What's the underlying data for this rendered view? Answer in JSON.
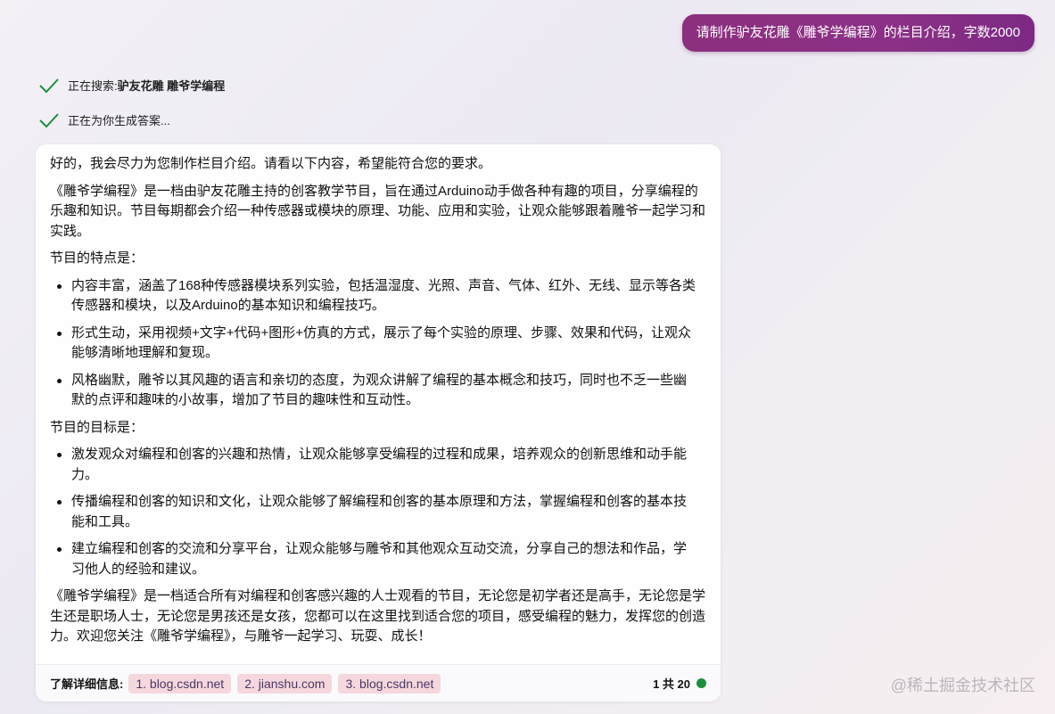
{
  "user_message": "请制作驴友花雕《雕爷学编程》的栏目介绍，字数2000",
  "status": {
    "searching_prefix": "正在搜索: ",
    "searching_query": "驴友花雕 雕爷学编程",
    "generating": "正在为你生成答案..."
  },
  "answer": {
    "intro": "好的，我会尽力为您制作栏目介绍。请看以下内容，希望能符合您的要求。",
    "para1": "《雕爷学编程》是一档由驴友花雕主持的创客教学节目，旨在通过Arduino动手做各种有趣的项目，分享编程的乐趣和知识。节目每期都会介绍一种传感器或模块的原理、功能、应用和实验，让观众能够跟着雕爷一起学习和实践。",
    "features_heading": "节目的特点是：",
    "features": [
      "内容丰富，涵盖了168种传感器模块系列实验，包括温湿度、光照、声音、气体、红外、无线、显示等各类传感器和模块，以及Arduino的基本知识和编程技巧。",
      "形式生动，采用视频+文字+代码+图形+仿真的方式，展示了每个实验的原理、步骤、效果和代码，让观众能够清晰地理解和复现。",
      "风格幽默，雕爷以其风趣的语言和亲切的态度，为观众讲解了编程的基本概念和技巧，同时也不乏一些幽默的点评和趣味的小故事，增加了节目的趣味性和互动性。"
    ],
    "goals_heading": "节目的目标是：",
    "goals": [
      "激发观众对编程和创客的兴趣和热情，让观众能够享受编程的过程和成果，培养观众的创新思维和动手能力。",
      "传播编程和创客的知识和文化，让观众能够了解编程和创客的基本原理和方法，掌握编程和创客的基本技能和工具。",
      "建立编程和创客的交流和分享平台，让观众能够与雕爷和其他观众互动交流，分享自己的想法和作品，学习他人的经验和建议。"
    ],
    "closing": "《雕爷学编程》是一档适合所有对编程和创客感兴趣的人士观看的节目，无论您是初学者还是高手，无论您是学生还是职场人士，无论您是男孩还是女孩，您都可以在这里找到适合您的项目，感受编程的魅力，发挥您的创造力。欢迎您关注《雕爷学编程》，与雕爷一起学习、玩耍、成长！"
  },
  "footer": {
    "label": "了解详细信息:",
    "sources": [
      "1. blog.csdn.net",
      "2. jianshu.com",
      "3. blog.csdn.net"
    ],
    "page_count": "1 共 20"
  },
  "watermark": "@稀土掘金技术社区",
  "colors": {
    "user_bubble": "#8b3086",
    "check": "#1e8e3e",
    "chip_bg": "#f5d7de",
    "status_dot": "#1e8e3e"
  },
  "icons": [
    "check-icon",
    "status-dot-icon"
  ]
}
